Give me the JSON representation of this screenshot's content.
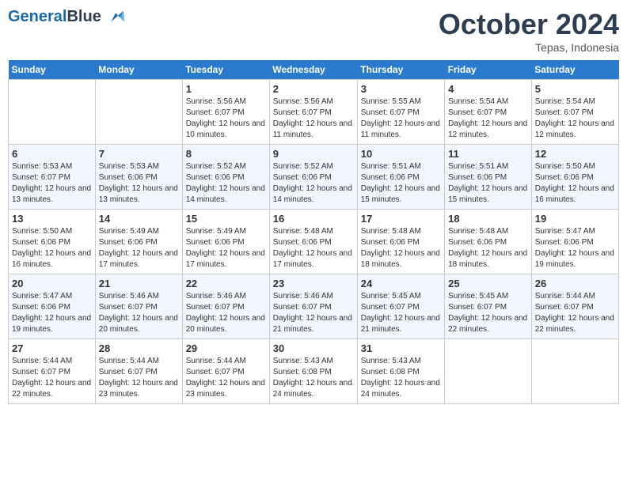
{
  "header": {
    "logo_general": "General",
    "logo_blue": "Blue",
    "month_title": "October 2024",
    "location": "Tepas, Indonesia"
  },
  "weekdays": [
    "Sunday",
    "Monday",
    "Tuesday",
    "Wednesday",
    "Thursday",
    "Friday",
    "Saturday"
  ],
  "weeks": [
    [
      {
        "day": "",
        "info": ""
      },
      {
        "day": "",
        "info": ""
      },
      {
        "day": "1",
        "info": "Sunrise: 5:56 AM\nSunset: 6:07 PM\nDaylight: 12 hours and 10 minutes."
      },
      {
        "day": "2",
        "info": "Sunrise: 5:56 AM\nSunset: 6:07 PM\nDaylight: 12 hours and 11 minutes."
      },
      {
        "day": "3",
        "info": "Sunrise: 5:55 AM\nSunset: 6:07 PM\nDaylight: 12 hours and 11 minutes."
      },
      {
        "day": "4",
        "info": "Sunrise: 5:54 AM\nSunset: 6:07 PM\nDaylight: 12 hours and 12 minutes."
      },
      {
        "day": "5",
        "info": "Sunrise: 5:54 AM\nSunset: 6:07 PM\nDaylight: 12 hours and 12 minutes."
      }
    ],
    [
      {
        "day": "6",
        "info": "Sunrise: 5:53 AM\nSunset: 6:07 PM\nDaylight: 12 hours and 13 minutes."
      },
      {
        "day": "7",
        "info": "Sunrise: 5:53 AM\nSunset: 6:06 PM\nDaylight: 12 hours and 13 minutes."
      },
      {
        "day": "8",
        "info": "Sunrise: 5:52 AM\nSunset: 6:06 PM\nDaylight: 12 hours and 14 minutes."
      },
      {
        "day": "9",
        "info": "Sunrise: 5:52 AM\nSunset: 6:06 PM\nDaylight: 12 hours and 14 minutes."
      },
      {
        "day": "10",
        "info": "Sunrise: 5:51 AM\nSunset: 6:06 PM\nDaylight: 12 hours and 15 minutes."
      },
      {
        "day": "11",
        "info": "Sunrise: 5:51 AM\nSunset: 6:06 PM\nDaylight: 12 hours and 15 minutes."
      },
      {
        "day": "12",
        "info": "Sunrise: 5:50 AM\nSunset: 6:06 PM\nDaylight: 12 hours and 16 minutes."
      }
    ],
    [
      {
        "day": "13",
        "info": "Sunrise: 5:50 AM\nSunset: 6:06 PM\nDaylight: 12 hours and 16 minutes."
      },
      {
        "day": "14",
        "info": "Sunrise: 5:49 AM\nSunset: 6:06 PM\nDaylight: 12 hours and 17 minutes."
      },
      {
        "day": "15",
        "info": "Sunrise: 5:49 AM\nSunset: 6:06 PM\nDaylight: 12 hours and 17 minutes."
      },
      {
        "day": "16",
        "info": "Sunrise: 5:48 AM\nSunset: 6:06 PM\nDaylight: 12 hours and 17 minutes."
      },
      {
        "day": "17",
        "info": "Sunrise: 5:48 AM\nSunset: 6:06 PM\nDaylight: 12 hours and 18 minutes."
      },
      {
        "day": "18",
        "info": "Sunrise: 5:48 AM\nSunset: 6:06 PM\nDaylight: 12 hours and 18 minutes."
      },
      {
        "day": "19",
        "info": "Sunrise: 5:47 AM\nSunset: 6:06 PM\nDaylight: 12 hours and 19 minutes."
      }
    ],
    [
      {
        "day": "20",
        "info": "Sunrise: 5:47 AM\nSunset: 6:06 PM\nDaylight: 12 hours and 19 minutes."
      },
      {
        "day": "21",
        "info": "Sunrise: 5:46 AM\nSunset: 6:07 PM\nDaylight: 12 hours and 20 minutes."
      },
      {
        "day": "22",
        "info": "Sunrise: 5:46 AM\nSunset: 6:07 PM\nDaylight: 12 hours and 20 minutes."
      },
      {
        "day": "23",
        "info": "Sunrise: 5:46 AM\nSunset: 6:07 PM\nDaylight: 12 hours and 21 minutes."
      },
      {
        "day": "24",
        "info": "Sunrise: 5:45 AM\nSunset: 6:07 PM\nDaylight: 12 hours and 21 minutes."
      },
      {
        "day": "25",
        "info": "Sunrise: 5:45 AM\nSunset: 6:07 PM\nDaylight: 12 hours and 22 minutes."
      },
      {
        "day": "26",
        "info": "Sunrise: 5:44 AM\nSunset: 6:07 PM\nDaylight: 12 hours and 22 minutes."
      }
    ],
    [
      {
        "day": "27",
        "info": "Sunrise: 5:44 AM\nSunset: 6:07 PM\nDaylight: 12 hours and 22 minutes."
      },
      {
        "day": "28",
        "info": "Sunrise: 5:44 AM\nSunset: 6:07 PM\nDaylight: 12 hours and 23 minutes."
      },
      {
        "day": "29",
        "info": "Sunrise: 5:44 AM\nSunset: 6:07 PM\nDaylight: 12 hours and 23 minutes."
      },
      {
        "day": "30",
        "info": "Sunrise: 5:43 AM\nSunset: 6:08 PM\nDaylight: 12 hours and 24 minutes."
      },
      {
        "day": "31",
        "info": "Sunrise: 5:43 AM\nSunset: 6:08 PM\nDaylight: 12 hours and 24 minutes."
      },
      {
        "day": "",
        "info": ""
      },
      {
        "day": "",
        "info": ""
      }
    ]
  ]
}
